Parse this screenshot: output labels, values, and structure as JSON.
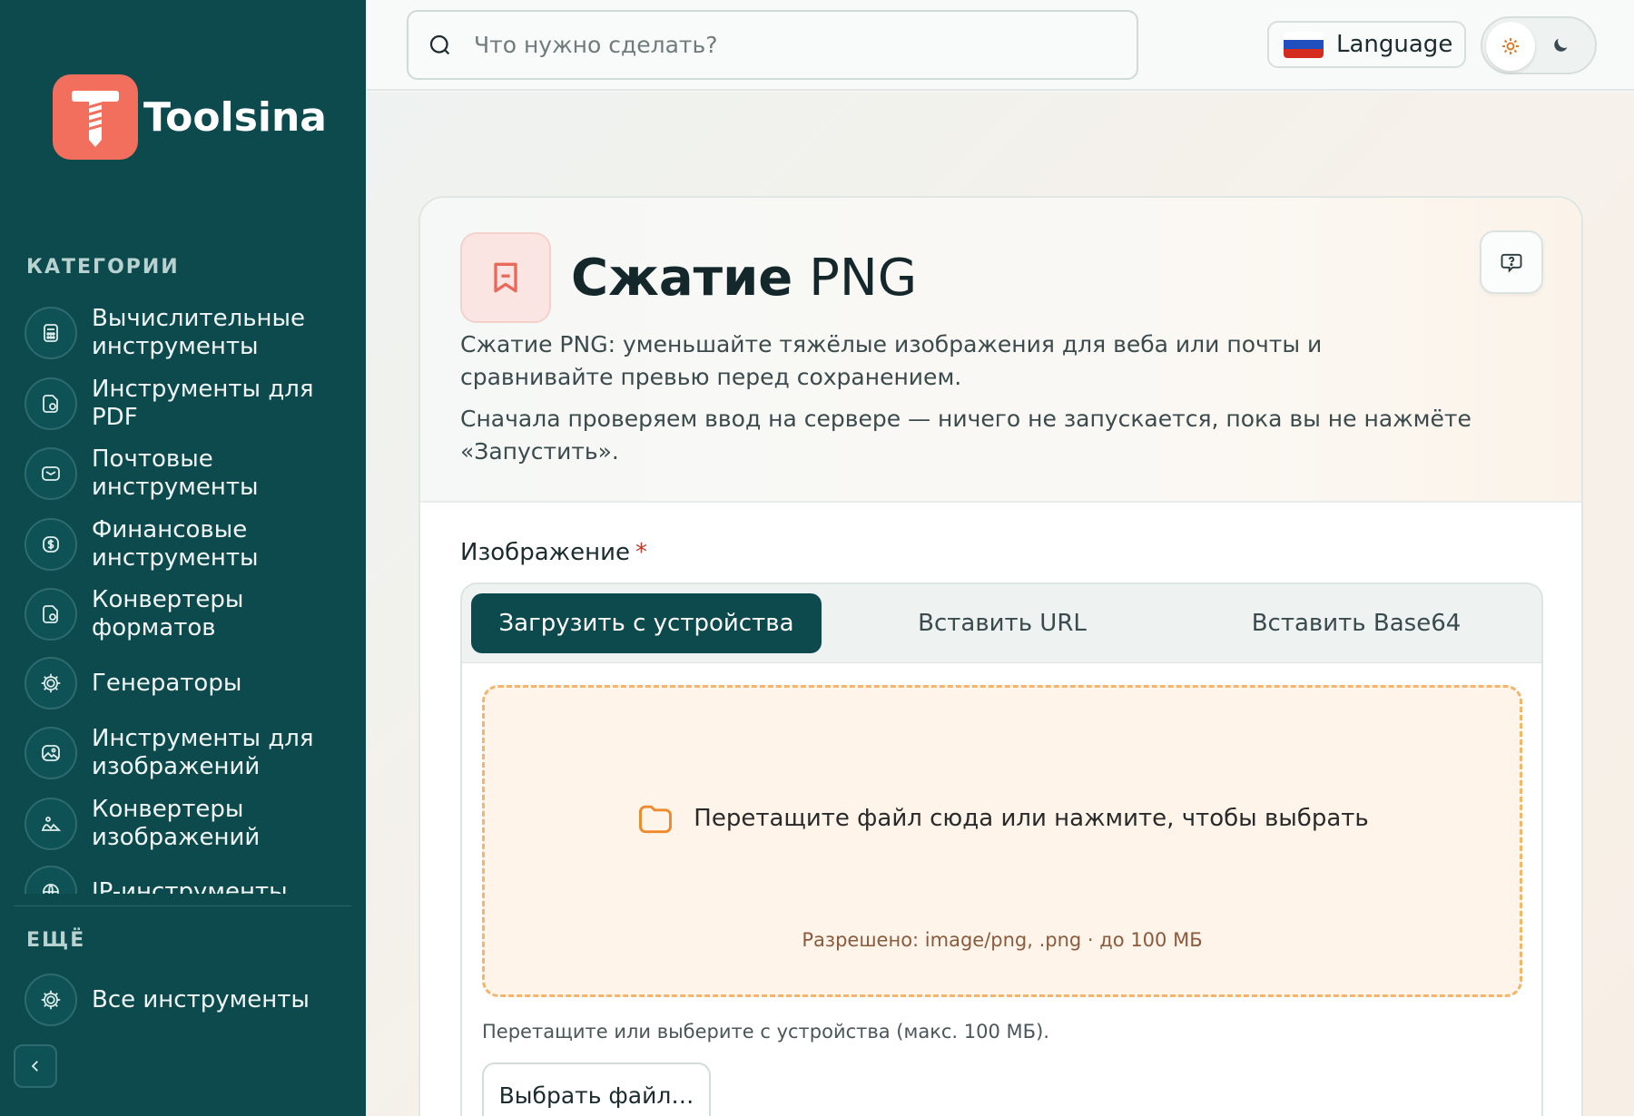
{
  "brand": {
    "name": "Toolsina"
  },
  "sidebar": {
    "categories_label": "КАТЕГОРИИ",
    "items": [
      {
        "label": "Вычислительные инструменты",
        "icon": "calculator-icon"
      },
      {
        "label": "Инструменты для PDF",
        "icon": "file-icon"
      },
      {
        "label": "Почтовые инструменты",
        "icon": "mail-icon"
      },
      {
        "label": "Финансовые инструменты",
        "icon": "dollar-icon"
      },
      {
        "label": "Конвертеры форматов",
        "icon": "convert-file-icon"
      },
      {
        "label": "Генераторы",
        "icon": "gear-icon"
      },
      {
        "label": "Инструменты для изображений",
        "icon": "image-icon"
      },
      {
        "label": "Конвертеры изображений",
        "icon": "image-convert-icon"
      },
      {
        "label": "IP-инструменты",
        "icon": "globe-icon"
      }
    ],
    "more_label": "ЕЩЁ",
    "all_tools_label": "Все инструменты"
  },
  "topbar": {
    "search_placeholder": "Что нужно сделать?",
    "language_label": "Language",
    "theme": "light"
  },
  "tool": {
    "title_bold": "Сжатие",
    "title_rest": "PNG",
    "description": "Сжатие PNG: уменьшайте тяжёлые изображения для веба или почты и сравнивайте превью перед сохранением.",
    "note": "Сначала проверяем ввод на сервере — ничего не запускается, пока вы не нажмёте «Запустить».",
    "field_label": "Изображение",
    "required_mark": "*",
    "tabs": [
      "Загрузить с устройства",
      "Вставить URL",
      "Вставить Base64"
    ],
    "active_tab": 0,
    "dropzone_text": "Перетащите файл сюда или нажмите, чтобы выбрать",
    "dropzone_hint": "Разрешено: image/png, .png · до 100 МБ",
    "helper_text": "Перетащите или выберите с устройства (макс. 100 МБ).",
    "choose_button": "Выбрать файл…"
  },
  "colors": {
    "sidebar_bg": "#0d4a4e",
    "brand_accent": "#f26f5e",
    "dropzone_border": "#f2b56b",
    "active_tab": "#0d4a4e"
  }
}
